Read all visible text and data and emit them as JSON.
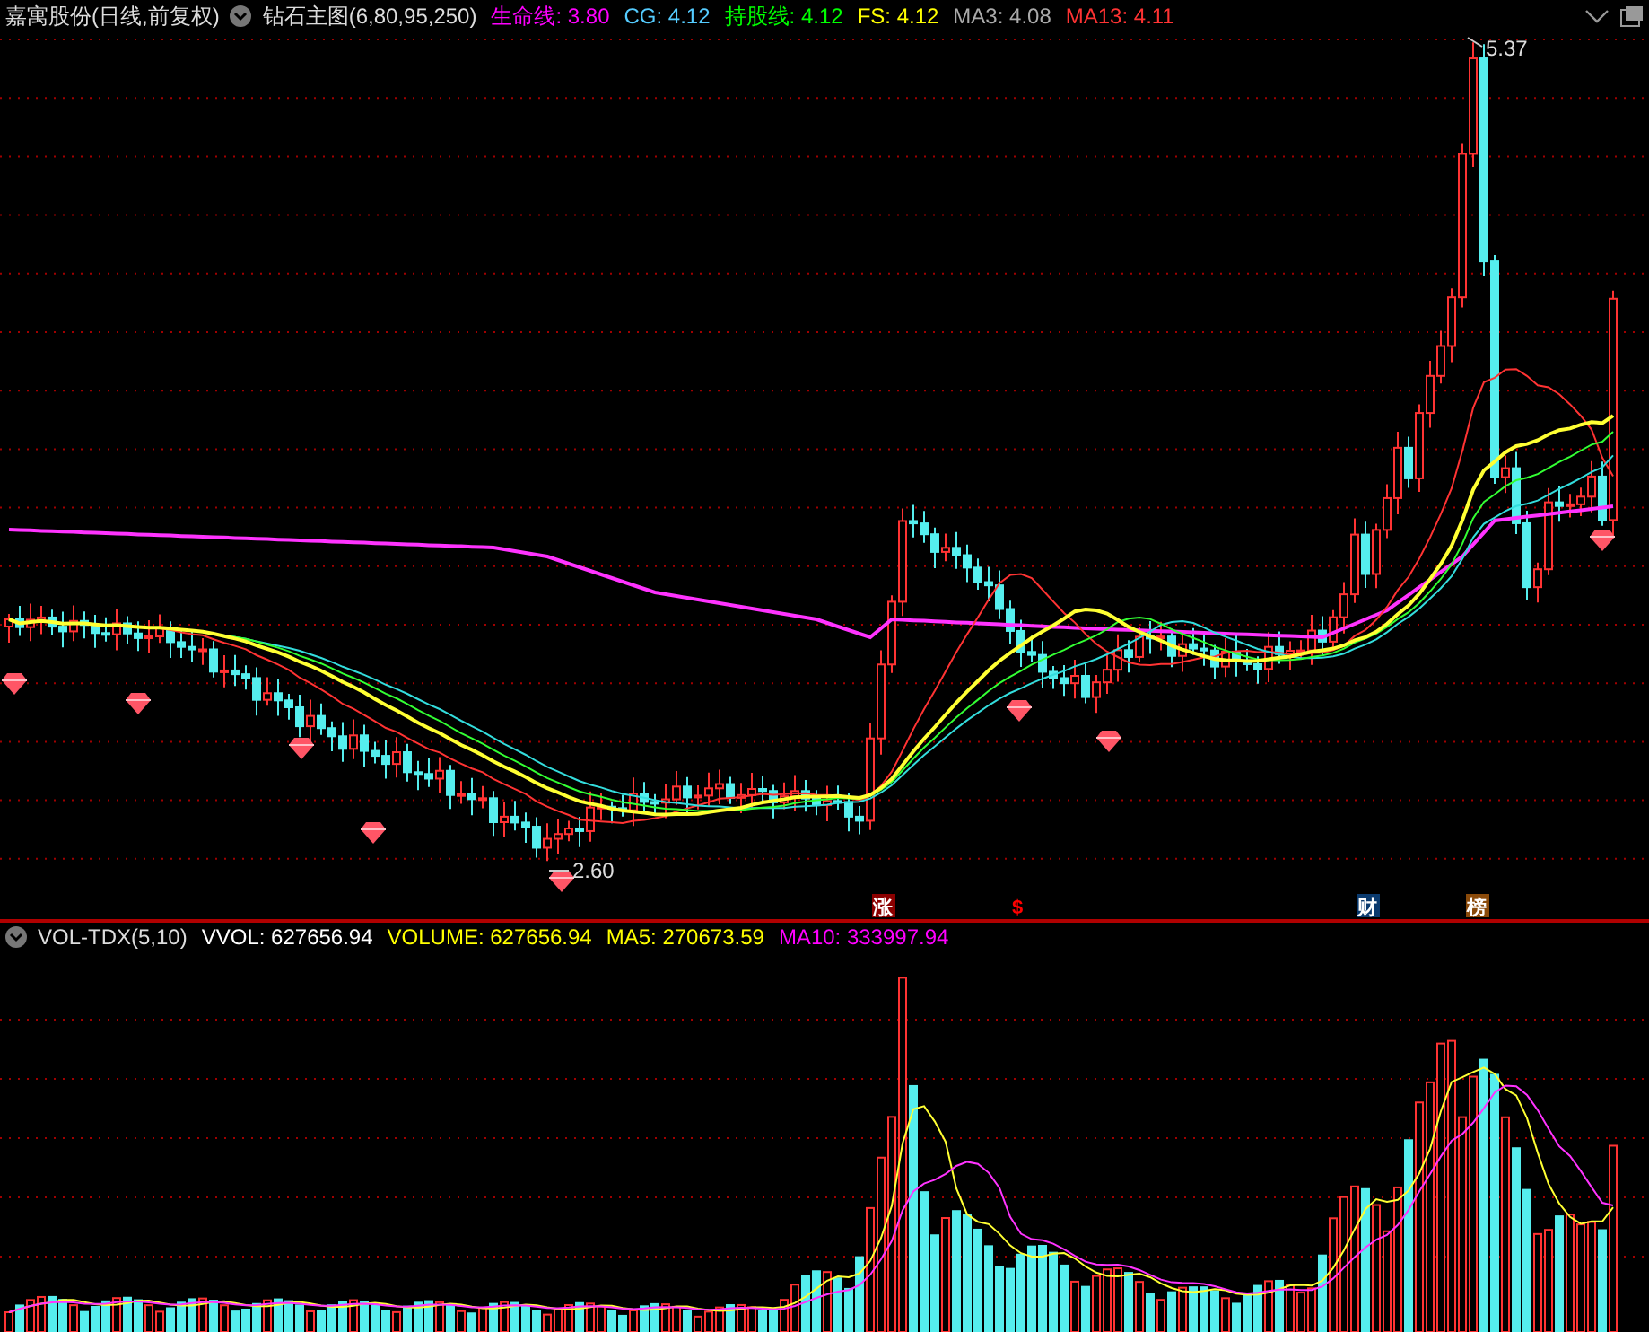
{
  "header": {
    "title": "嘉寓股份(日线,前复权)",
    "indicator": "钻石主图(6,80,95,250)",
    "legend": [
      {
        "label": "生命线:",
        "value": "3.80",
        "color": "#ff00ff"
      },
      {
        "label": "CG:",
        "value": "4.12",
        "color": "#55ccff"
      },
      {
        "label": "持股线:",
        "value": "4.12",
        "color": "#00ff00"
      },
      {
        "label": "FS:",
        "value": "4.12",
        "color": "#ffff00"
      },
      {
        "label": "MA3:",
        "value": "4.08",
        "color": "#aaaaaa"
      },
      {
        "label": "MA13:",
        "value": "4.11",
        "color": "#ff3333"
      }
    ]
  },
  "price_chart": {
    "high_label": "5.37",
    "low_label": "2.60",
    "events": [
      {
        "label": "涨",
        "kind": "badge",
        "color": "#8b0000"
      },
      {
        "label": "$",
        "kind": "text",
        "color": "#ff0000"
      },
      {
        "label": "财",
        "kind": "badge",
        "color": "#0a3a6e"
      },
      {
        "label": "榜",
        "kind": "badge",
        "color": "#8a4a0a"
      }
    ]
  },
  "volume_header": {
    "title": "VOL-TDX(5,10)",
    "legend": [
      {
        "label": "VVOL:",
        "value": "627656.94",
        "color": "#ffffff"
      },
      {
        "label": "VOLUME:",
        "value": "627656.94",
        "color": "#ffff00"
      },
      {
        "label": "MA5:",
        "value": "270673.59",
        "color": "#ffff00"
      },
      {
        "label": "MA10:",
        "value": "333997.94",
        "color": "#ff00ff"
      }
    ]
  }
}
